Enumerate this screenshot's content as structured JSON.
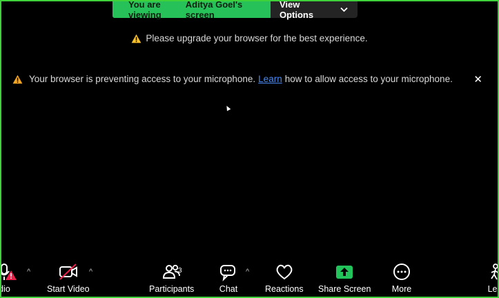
{
  "banner": {
    "prefix": "You are viewing",
    "name": "Aditya Goel's screen",
    "view_options": "View Options"
  },
  "notices": {
    "upgrade": "Please upgrade your browser for the best experience.",
    "mic_before": "Your browser is preventing access to your microphone.",
    "mic_link": "Learn",
    "mic_after": "how to allow access to your microphone.",
    "close": "✕"
  },
  "toolbar": {
    "audio": "udio",
    "start_video": "Start Video",
    "participants": "Participants",
    "participants_count": "3",
    "chat": "Chat",
    "reactions": "Reactions",
    "share_screen": "Share Screen",
    "more": "More",
    "leave": "Lea"
  },
  "colors": {
    "border": "#3fd13a",
    "banner_green": "#27c15a",
    "share_green": "#22c35a",
    "link": "#4a8bf5",
    "alert": "#e8204a"
  }
}
